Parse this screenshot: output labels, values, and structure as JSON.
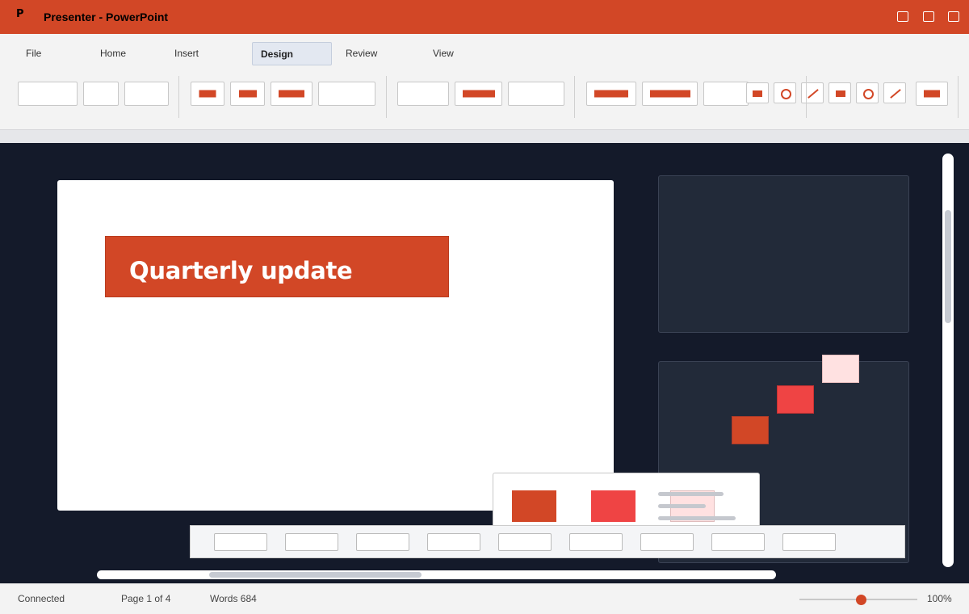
{
  "app": {
    "icon_letter": "P",
    "title": "Presenter - PowerPoint",
    "accent_color": "#d24726"
  },
  "menu": {
    "tabs": [
      {
        "label": "File"
      },
      {
        "label": "Home"
      },
      {
        "label": "Insert"
      },
      {
        "label": "Design",
        "active": true
      },
      {
        "label": "Review"
      },
      {
        "label": "View"
      }
    ]
  },
  "ribbon": {
    "icons": [
      "rectangle-icon",
      "circle-icon",
      "line-icon",
      "rectangle-icon",
      "circle-icon",
      "line-icon",
      "rectangle-icon"
    ]
  },
  "slide": {
    "title": "Quarterly update"
  },
  "swatch_colors": [
    "#ffe1e1",
    "#ef4444",
    "#d24726"
  ],
  "status": {
    "connection": "Connected",
    "page": "Page 1 of 4",
    "words": "Words 684",
    "zoom": "100%"
  }
}
